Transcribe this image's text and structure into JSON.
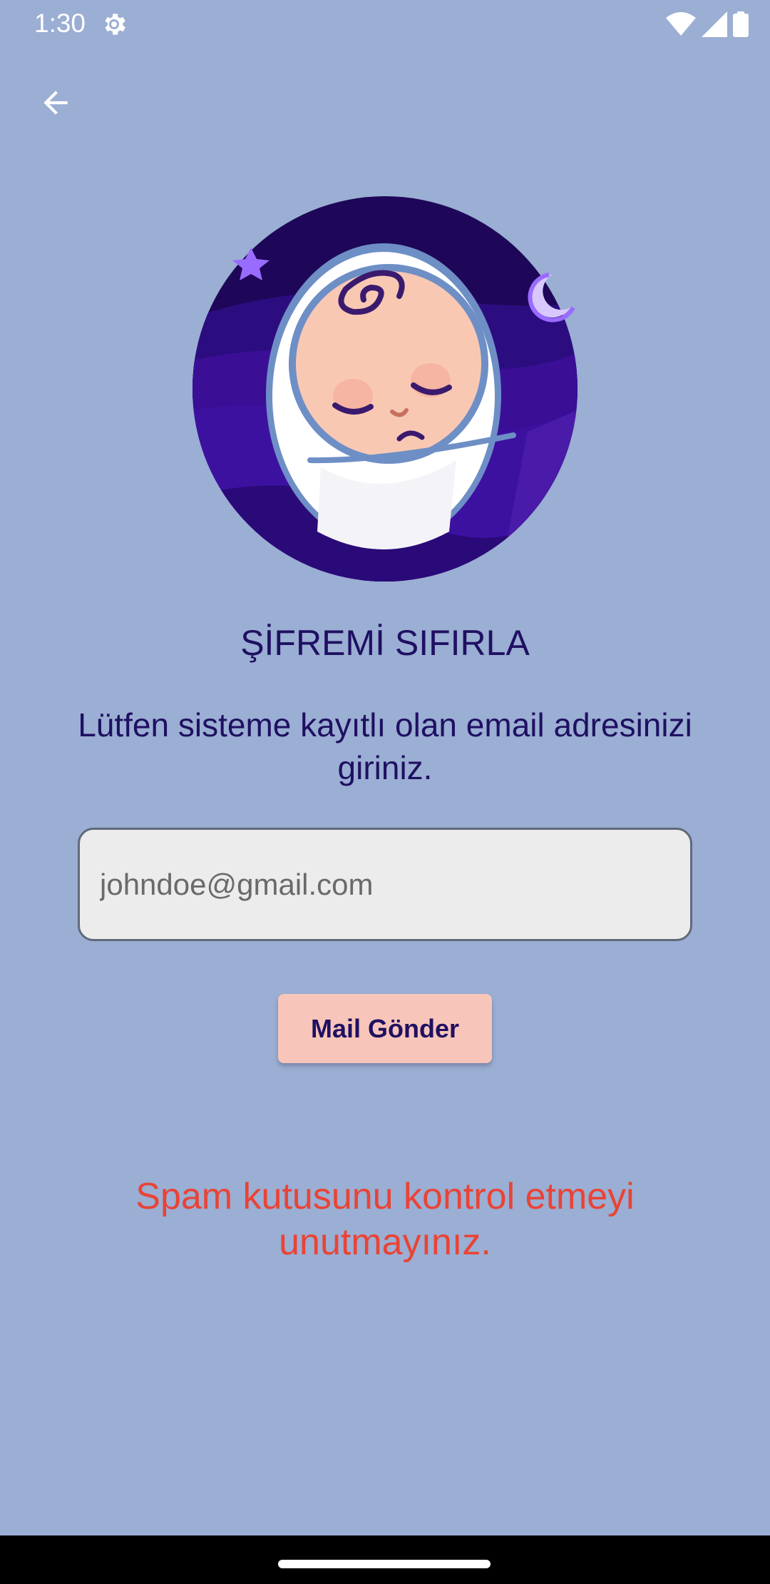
{
  "status_bar": {
    "time": "1:30",
    "icons": [
      "settings-gear-icon",
      "wifi-icon",
      "signal-icon",
      "battery-icon"
    ]
  },
  "header": {
    "back_icon": "arrow-back-icon"
  },
  "illustration": {
    "name": "sleeping-baby-logo",
    "colors": {
      "background": "#2a0a6b",
      "swaddle": "#ffffff",
      "outline": "#6e8fc6",
      "skin": "#f9c8b3",
      "accent": "#9a6bff"
    }
  },
  "content": {
    "title": "ŞİFREMİ SIFIRLA",
    "instruction": "Lütfen sisteme kayıtlı olan email adresinizi giriniz.",
    "email_placeholder": "johndoe@gmail.com",
    "send_button_label": "Mail Gönder",
    "spam_note": "Spam kutusunu kontrol etmeyi unutmayınız."
  },
  "colors": {
    "background": "#9baed3",
    "text_primary": "#1f1062",
    "button_bg": "#f7c5b9",
    "warning_text": "#ea4335",
    "input_bg": "#ececec"
  }
}
